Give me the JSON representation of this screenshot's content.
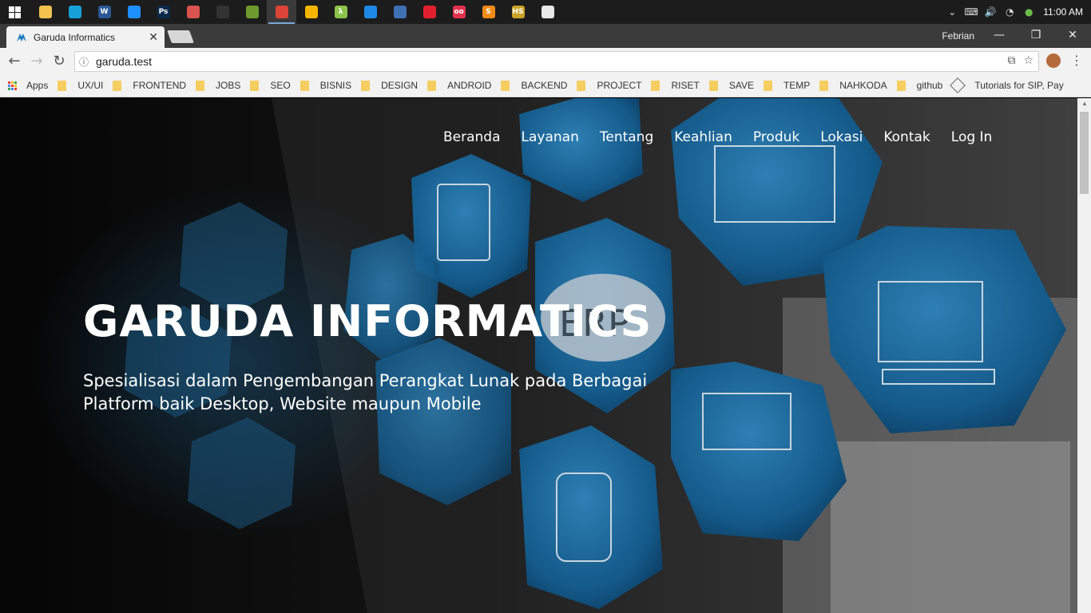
{
  "taskbar": {
    "apps": [
      {
        "name": "file-explorer-icon",
        "color": "#f2c14e",
        "glyph": ""
      },
      {
        "name": "search-app-icon",
        "color": "#16a0d8",
        "glyph": ""
      },
      {
        "name": "word-icon",
        "color": "#2b5797",
        "glyph": "W"
      },
      {
        "name": "app-blue-icon",
        "color": "#1e90ff",
        "glyph": ""
      },
      {
        "name": "photoshop-icon",
        "color": "#0b2a4a",
        "glyph": "Ps"
      },
      {
        "name": "paint-icon",
        "color": "#d9534f",
        "glyph": ""
      },
      {
        "name": "obs-icon",
        "color": "#333333",
        "glyph": ""
      },
      {
        "name": "app-green-icon",
        "color": "#6c9a2e",
        "glyph": ""
      },
      {
        "name": "chrome-icon",
        "color": "#db4437",
        "glyph": "",
        "active": true
      },
      {
        "name": "keep-icon",
        "color": "#f4b400",
        "glyph": ""
      },
      {
        "name": "lambda-icon",
        "color": "#8bc34a",
        "glyph": "λ"
      },
      {
        "name": "app-teal-icon",
        "color": "#1e88e5",
        "glyph": ""
      },
      {
        "name": "network-icon",
        "color": "#3f6fb5",
        "glyph": ""
      },
      {
        "name": "opera-icon",
        "color": "#e0202f",
        "glyph": ""
      },
      {
        "name": "dots-app-icon",
        "color": "#e2314d",
        "glyph": "oo"
      },
      {
        "name": "sublime-icon",
        "color": "#f38b17",
        "glyph": "S"
      },
      {
        "name": "hs-app-icon",
        "color": "#c9a227",
        "glyph": "HS"
      },
      {
        "name": "window-app-icon",
        "color": "#e8e8e8",
        "glyph": ""
      }
    ],
    "clock": "11:00 AM"
  },
  "browser": {
    "tab_title": "Garuda Informatics",
    "profile_name": "Febrian",
    "url": "garuda.test",
    "bookmarks": [
      "Apps",
      "UX/UI",
      "FRONTEND",
      "JOBS",
      "SEO",
      "BISNIS",
      "DESIGN",
      "ANDROID",
      "BACKEND",
      "PROJECT",
      "RISET",
      "SAVE",
      "TEMP",
      "NAHKODA",
      "github"
    ],
    "bookmark_extension": "Tutorials for SIP, Pay"
  },
  "site": {
    "nav": [
      "Beranda",
      "Layanan",
      "Tentang",
      "Keahlian",
      "Produk",
      "Lokasi",
      "Kontak",
      "Log In"
    ],
    "title": "GARUDA INFORMATICS",
    "subtitle": "Spesialisasi dalam Pengembangan Perangkat Lunak pada Berbagai Platform baik Desktop, Website maupun Mobile",
    "hex_labels": [
      "ERP"
    ]
  }
}
